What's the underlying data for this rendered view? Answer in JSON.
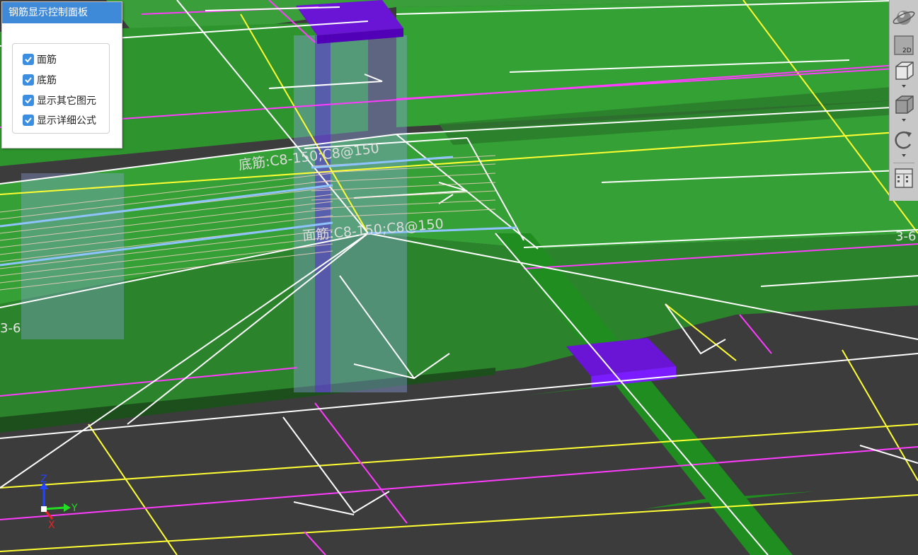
{
  "panel": {
    "title": "钢筋显示控制面板",
    "options": [
      {
        "label": "面筋",
        "checked": true
      },
      {
        "label": "底筋",
        "checked": true
      },
      {
        "label": "显示其它图元",
        "checked": true
      },
      {
        "label": "显示详细公式",
        "checked": true
      }
    ]
  },
  "scene": {
    "rebar_label_bottom": "底筋:C8-150;C8@150",
    "rebar_label_top": "面筋:C8-150;C8@150",
    "axis_label_right": "3-6",
    "axis_label_left": "3-6",
    "axes": {
      "z": "Z",
      "y": "Y",
      "x": "X"
    }
  },
  "toolbar": {
    "buttons": [
      {
        "name": "orbit-view-icon"
      },
      {
        "name": "2d-view-icon",
        "text": "2D"
      },
      {
        "name": "3d-box-view-icon"
      },
      {
        "name": "dynamic-observe-icon"
      },
      {
        "name": "rotate-icon"
      },
      {
        "name": "layer-settings-icon"
      }
    ]
  },
  "colors": {
    "background": "#3c3c3c",
    "slab_green": "#2f9a2f",
    "column_purple": "#6a14d6",
    "rebar_blue": "#8fc3ff",
    "grid_yellow": "#ffff33",
    "grid_magenta": "#ff3cff",
    "panel_title_blue": "#3f8ad8"
  }
}
